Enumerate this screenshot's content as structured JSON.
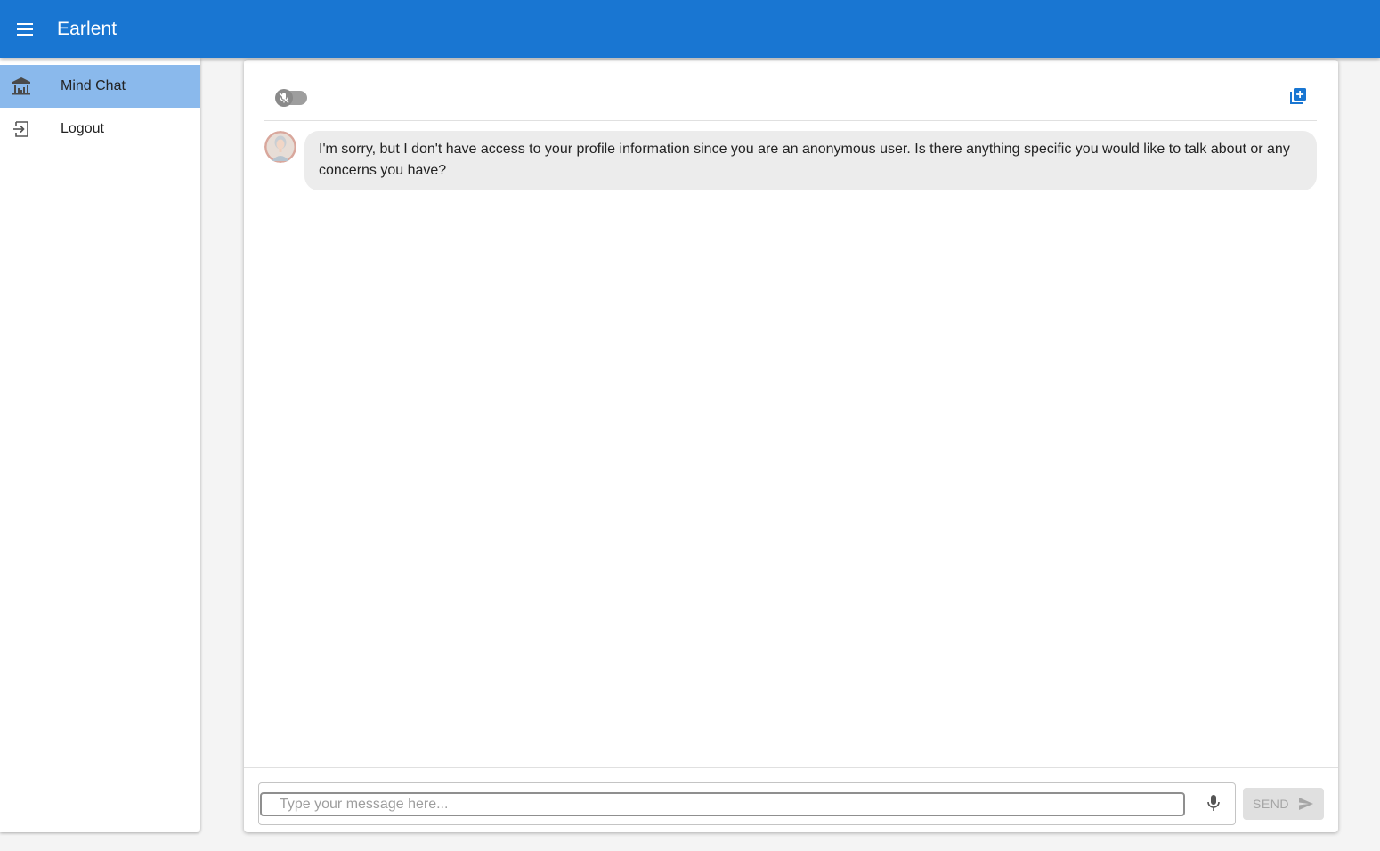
{
  "app": {
    "title": "Earlent"
  },
  "sidebar": {
    "items": [
      {
        "label": "Mind Chat",
        "icon": "building-columns-icon",
        "active": true
      },
      {
        "label": "Logout",
        "icon": "logout-icon",
        "active": false
      }
    ]
  },
  "chat": {
    "toolbar": {
      "toggle_icon": "mic-off-icon",
      "new_chat_icon": "add-box-icon"
    },
    "messages": [
      {
        "sender": "assistant",
        "text": "I'm sorry, but I don't have access to your profile information since you are an anonymous user. Is there anything specific you would like to talk about or any concerns you have?"
      }
    ],
    "input": {
      "placeholder": "Type your message here...",
      "value": ""
    },
    "send_label": "SEND"
  },
  "colors": {
    "appbar": "#1976d2",
    "active_nav": "#8ab9ec",
    "bubble": "#ececec",
    "send_disabled_bg": "#e0e0e0"
  }
}
